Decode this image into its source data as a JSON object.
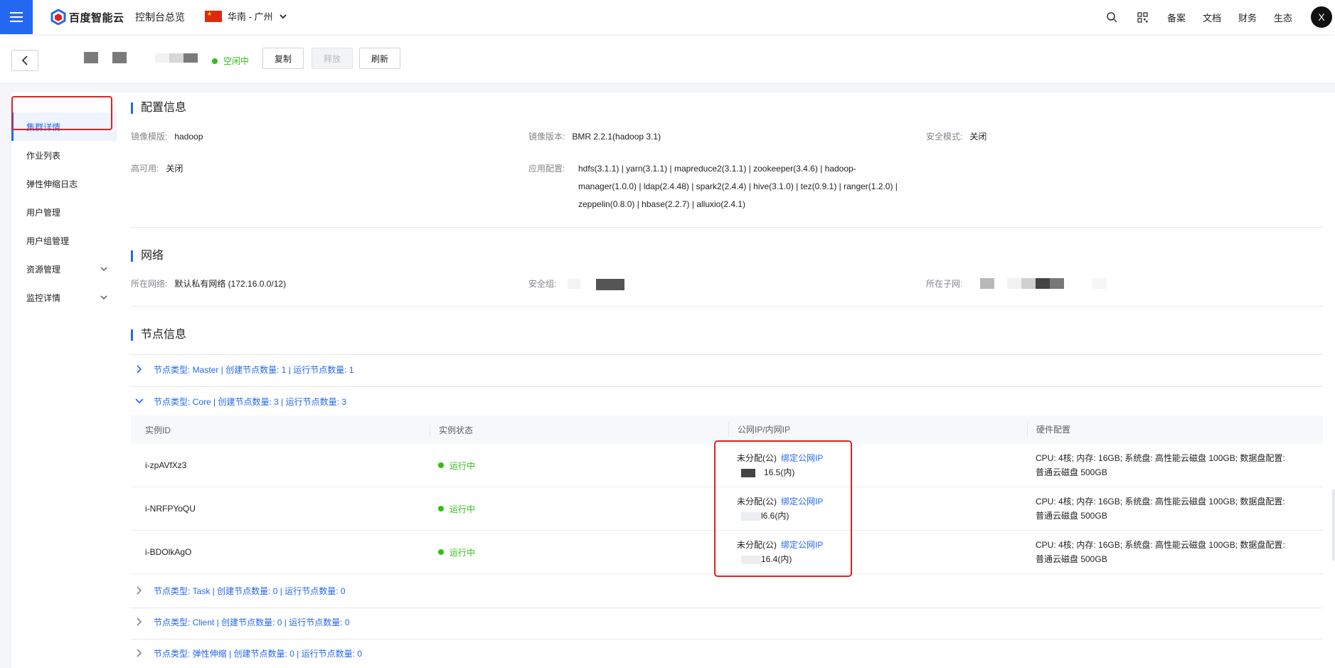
{
  "topbar": {
    "logo_text": "百度智能云",
    "console_label": "控制台总览",
    "region_label": "华南 - 广州",
    "links": [
      "备案",
      "文档",
      "财务",
      "生态"
    ],
    "avatar_letter": "X",
    "brand_color": "#2468f2"
  },
  "subheader": {
    "status": "空闲中",
    "buttons": {
      "copy": "复制",
      "release": "释放",
      "refresh": "刷新"
    }
  },
  "sidebar": {
    "items": [
      {
        "label": "集群详情",
        "active": true
      },
      {
        "label": "作业列表"
      },
      {
        "label": "弹性伸缩日志"
      },
      {
        "label": "用户管理"
      },
      {
        "label": "用户组管理"
      },
      {
        "label": "资源管理",
        "expandable": true
      },
      {
        "label": "监控详情",
        "expandable": true
      }
    ]
  },
  "config": {
    "title": "配置信息",
    "image_template_label": "镜像模版:",
    "image_template_value": "hadoop",
    "image_version_label": "镜像版本:",
    "image_version_value": "BMR 2.2.1(hadoop 3.1)",
    "security_mode_label": "安全模式:",
    "security_mode_value": "关闭",
    "ha_label": "高可用:",
    "ha_value": "关闭",
    "app_config_label": "应用配置:",
    "app_config_lines": [
      "hdfs(3.1.1) | yarn(3.1.1) | mapreduce2(3.1.1) | zookeeper(3.4.6) | hadoop-",
      "manager(1.0.0) | ldap(2.4.48) | spark2(2.4.4) | hive(3.1.0) | tez(0.9.1) | ranger(1.2.0) |",
      "zeppelin(0.8.0) | hbase(2.2.7) | alluxio(2.4.1)"
    ]
  },
  "network": {
    "title": "网络",
    "vpc_label": "所在网络:",
    "vpc_value": "默认私有网络 (172.16.0.0/12)",
    "sg_label": "安全组:",
    "subnet_label": "所在子网:"
  },
  "nodes": {
    "title": "节点信息",
    "groups": [
      {
        "label": "节点类型: Master | 创建节点数量: 1 | 运行节点数量: 1",
        "expanded": false
      },
      {
        "label": "节点类型: Core | 创建节点数量: 3 | 运行节点数量: 3",
        "expanded": true
      },
      {
        "label": "节点类型: Task | 创建节点数量: 0 | 运行节点数量: 0",
        "expanded": false
      },
      {
        "label": "节点类型: Client | 创建节点数量: 0 | 运行节点数量: 0",
        "expanded": false
      },
      {
        "label": "节点类型: 弹性伸缩 | 创建节点数量: 0 | 运行节点数量: 0",
        "expanded": false
      }
    ],
    "table": {
      "headers": [
        "实例ID",
        "实例状态",
        "公网IP/内网IP",
        "硬件配置"
      ],
      "rows": [
        {
          "id": "i-zpAVfXz3",
          "status": "运行中",
          "public": "未分配(公)",
          "bind": "绑定公网IP",
          "private": "16.5(内)",
          "hw1": "CPU: 4核; 内存: 16GB; 系统盘: 高性能云磁盘 100GB; 数据盘配置:",
          "hw2": "普通云磁盘 500GB"
        },
        {
          "id": "i-NRFPYoQU",
          "status": "运行中",
          "public": "未分配(公)",
          "bind": "绑定公网IP",
          "private": "l6.6(内)",
          "hw1": "CPU: 4核; 内存: 16GB; 系统盘: 高性能云磁盘 100GB; 数据盘配置:",
          "hw2": "普通云磁盘 500GB"
        },
        {
          "id": "i-BDOlkAgO",
          "status": "运行中",
          "public": "未分配(公)",
          "bind": "绑定公网IP",
          "private": "16.4(内)",
          "hw1": "CPU: 4核; 内存: 16GB; 系统盘: 高性能云磁盘 100GB; 数据盘配置:",
          "hw2": "普通云磁盘 500GB"
        }
      ]
    }
  }
}
